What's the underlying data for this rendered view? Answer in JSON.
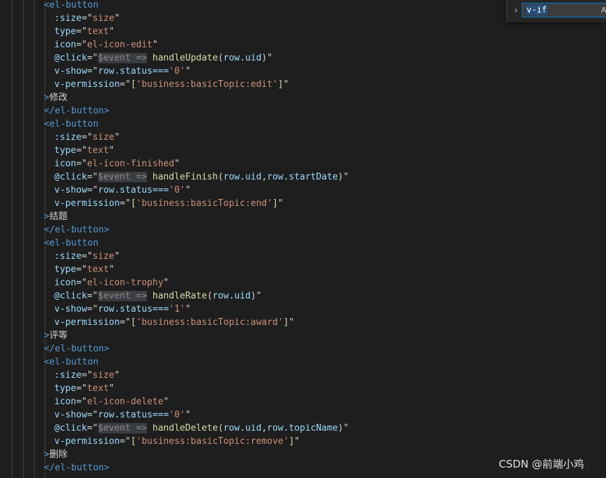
{
  "editor": {
    "lines": [
      {
        "kind": "open",
        "tag": "<el-button"
      },
      {
        "kind": "attr",
        "name": ":size",
        "value": "size"
      },
      {
        "kind": "attr",
        "name": "type",
        "value": "text"
      },
      {
        "kind": "attr",
        "name": "icon",
        "value": "el-icon-edit"
      },
      {
        "kind": "click",
        "param": "$event",
        "arrow": "=>",
        "fn": "handleUpdate",
        "args": [
          "row.uid"
        ]
      },
      {
        "kind": "show",
        "expr": "row.status===",
        "lit": "'0'"
      },
      {
        "kind": "perm",
        "value": "'business:basicTopic:edit'"
      },
      {
        "kind": "text",
        "value": "修改"
      },
      {
        "kind": "close",
        "tag": "</el-button>"
      },
      {
        "kind": "open",
        "tag": "<el-button"
      },
      {
        "kind": "attr",
        "name": ":size",
        "value": "size"
      },
      {
        "kind": "attr",
        "name": "type",
        "value": "text"
      },
      {
        "kind": "attr",
        "name": "icon",
        "value": "el-icon-finished"
      },
      {
        "kind": "click",
        "param": "$event",
        "arrow": "=>",
        "fn": "handleFinish",
        "args": [
          "row.uid",
          "row.startDate"
        ]
      },
      {
        "kind": "show",
        "expr": "row.status===",
        "lit": "'0'"
      },
      {
        "kind": "perm",
        "value": "'business:basicTopic:end'"
      },
      {
        "kind": "text",
        "value": "结题"
      },
      {
        "kind": "close",
        "tag": "</el-button>"
      },
      {
        "kind": "open",
        "tag": "<el-button"
      },
      {
        "kind": "attr",
        "name": ":size",
        "value": "size"
      },
      {
        "kind": "attr",
        "name": "type",
        "value": "text"
      },
      {
        "kind": "attr",
        "name": "icon",
        "value": "el-icon-trophy"
      },
      {
        "kind": "click",
        "param": "$event",
        "arrow": "=>",
        "fn": "handleRate",
        "args": [
          "row.uid"
        ]
      },
      {
        "kind": "show",
        "expr": "row.status===",
        "lit": "'1'"
      },
      {
        "kind": "perm",
        "value": "'business:basicTopic:award'"
      },
      {
        "kind": "text",
        "value": "评等"
      },
      {
        "kind": "close",
        "tag": "</el-button>"
      },
      {
        "kind": "open",
        "tag": "<el-button"
      },
      {
        "kind": "attr",
        "name": ":size",
        "value": "size"
      },
      {
        "kind": "attr",
        "name": "type",
        "value": "text"
      },
      {
        "kind": "attr",
        "name": "icon",
        "value": "el-icon-delete"
      },
      {
        "kind": "show",
        "expr": "row.status===",
        "lit": "'0'"
      },
      {
        "kind": "click",
        "param": "$event",
        "arrow": "=>",
        "fn": "handleDelete",
        "args": [
          "row.uid",
          "row.topicName"
        ]
      },
      {
        "kind": "perm",
        "value": "'business:basicTopic:remove'"
      },
      {
        "kind": "text",
        "value": "删除"
      },
      {
        "kind": "close",
        "tag": "</el-button>"
      }
    ]
  },
  "find_widget": {
    "query": "v-if",
    "match_case_label": "Aa",
    "toggle_icon": "chevron-right-icon"
  },
  "watermark": "CSDN @前端小鸡",
  "colors": {
    "background": "#1e1e1e",
    "tag": "#569cd6",
    "attribute": "#9cdcfe",
    "string": "#ce9178",
    "function": "#dcdcaa",
    "text": "#d4d4d4"
  }
}
